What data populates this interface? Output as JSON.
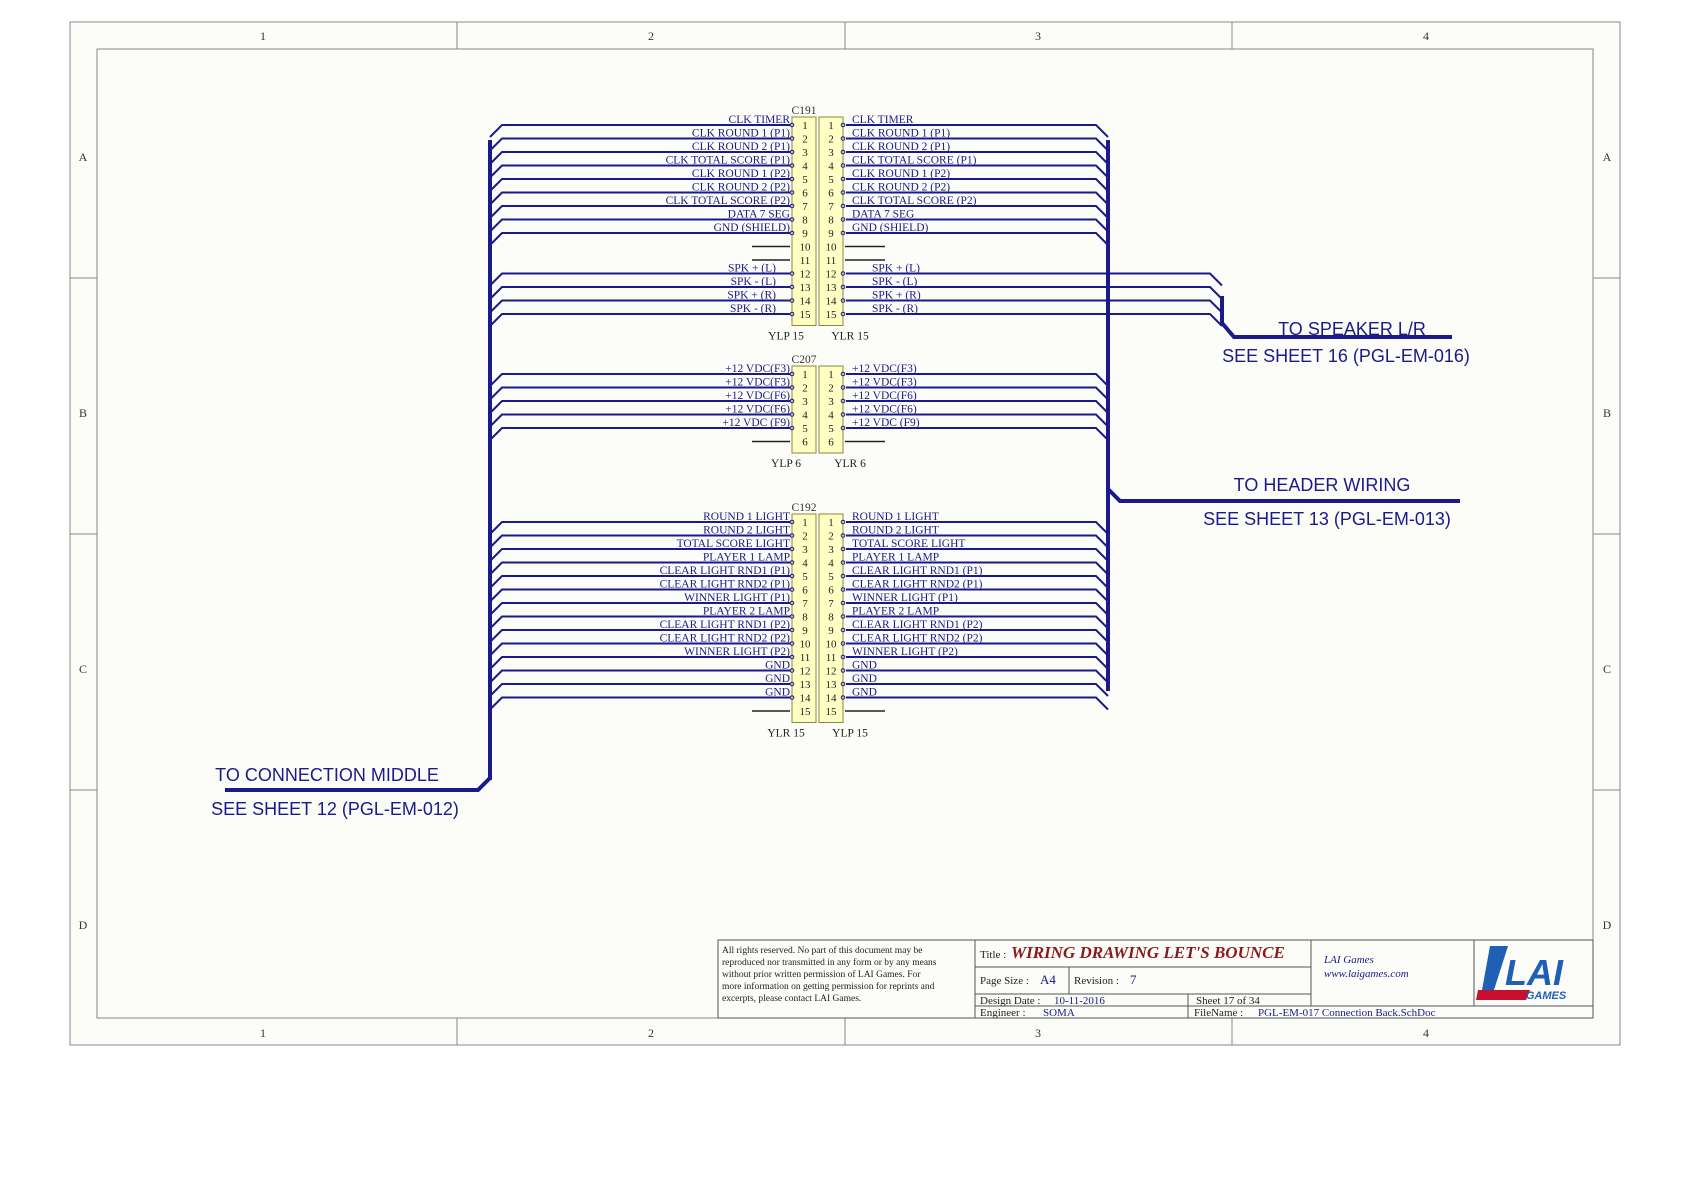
{
  "frame": {
    "columns": [
      "1",
      "2",
      "3",
      "4"
    ],
    "rows": [
      "A",
      "B",
      "C",
      "D"
    ]
  },
  "colors": {
    "wire": "#1a1a8c",
    "label": "#1a1a8c",
    "connector_fill": "#ffffc4",
    "connector_stroke": "#8a8a3a",
    "sheet_bg": "#fcfcf8",
    "title_red": "#8b1a1a"
  },
  "connectors": {
    "c191": {
      "ref": "C191",
      "left_name": "YLP 15",
      "right_name": "YLR 15",
      "pins": [
        "1",
        "2",
        "3",
        "4",
        "5",
        "6",
        "7",
        "8",
        "9",
        "10",
        "11",
        "12",
        "13",
        "14",
        "15"
      ],
      "left_labels": [
        "CLK TIMER",
        "CLK ROUND 1 (P1)",
        "CLK ROUND 2 (P1)",
        "CLK TOTAL SCORE (P1)",
        "CLK ROUND 1 (P2)",
        "CLK ROUND 2 (P2)",
        "CLK TOTAL SCORE (P2)",
        "DATA 7 SEG",
        "GND (SHIELD)",
        "",
        "",
        "SPK + (L)",
        "SPK - (L)",
        "SPK + (R)",
        "SPK - (R)"
      ],
      "right_labels": [
        "CLK TIMER",
        "CLK ROUND 1 (P1)",
        "CLK ROUND 2 (P1)",
        "CLK TOTAL SCORE (P1)",
        "CLK ROUND 1 (P2)",
        "CLK ROUND 2 (P2)",
        "CLK TOTAL SCORE (P2)",
        "DATA 7 SEG",
        "GND (SHIELD)",
        "",
        "",
        "SPK + (L)",
        "SPK - (L)",
        "SPK + (R)",
        "SPK - (R)"
      ]
    },
    "c207": {
      "ref": "C207",
      "left_name": "YLP 6",
      "right_name": "YLR 6",
      "pins": [
        "1",
        "2",
        "3",
        "4",
        "5",
        "6"
      ],
      "left_labels": [
        "+12 VDC(F3)",
        "+12 VDC(F3)",
        "+12 VDC(F6)",
        "+12 VDC(F6)",
        "+12 VDC (F9)",
        ""
      ],
      "right_labels": [
        "+12 VDC(F3)",
        "+12 VDC(F3)",
        "+12 VDC(F6)",
        "+12 VDC(F6)",
        "+12 VDC (F9)",
        ""
      ]
    },
    "c192": {
      "ref": "C192",
      "left_name": "YLR 15",
      "right_name": "YLP 15",
      "pins": [
        "1",
        "2",
        "3",
        "4",
        "5",
        "6",
        "7",
        "8",
        "9",
        "10",
        "11",
        "12",
        "13",
        "14",
        "15"
      ],
      "left_labels": [
        "ROUND 1 LIGHT",
        "ROUND 2 LIGHT",
        "TOTAL SCORE LIGHT",
        "PLAYER 1 LAMP",
        "CLEAR LIGHT RND1 (P1)",
        "CLEAR LIGHT RND2 (P1)",
        "WINNER LIGHT (P1)",
        "PLAYER 2 LAMP",
        "CLEAR LIGHT RND1 (P2)",
        "CLEAR LIGHT RND2 (P2)",
        "WINNER LIGHT (P2)",
        "GND",
        "GND",
        "GND",
        ""
      ],
      "right_labels": [
        "ROUND 1 LIGHT",
        "ROUND 2 LIGHT",
        "TOTAL SCORE LIGHT",
        "PLAYER 1 LAMP",
        "CLEAR LIGHT RND1 (P1)",
        "CLEAR LIGHT RND2 (P1)",
        "WINNER LIGHT (P1)",
        "PLAYER 2 LAMP",
        "CLEAR LIGHT RND1 (P2)",
        "CLEAR LIGHT RND2 (P2)",
        "WINNER LIGHT (P2)",
        "GND",
        "GND",
        "GND",
        ""
      ]
    }
  },
  "offsheet": {
    "speaker_title": "TO SPEAKER L/R",
    "speaker_ref": "SEE SHEET 16 (PGL-EM-016)",
    "header_title": "TO HEADER WIRING",
    "header_ref": "SEE SHEET 13 (PGL-EM-013)",
    "middle_title": "TO CONNECTION MIDDLE",
    "middle_ref": "SEE SHEET 12 (PGL-EM-012)"
  },
  "title_block": {
    "notice": [
      "All rights reserved. No part of this document may be",
      "reproduced nor transmitted in any form or by any means",
      "without prior written permission of LAI Games. For",
      "more information on getting permission for reprints and",
      "excerpts, please contact LAI Games."
    ],
    "title_label": "Title :",
    "title": "WIRING DRAWING LET'S BOUNCE",
    "page_size_label": "Page Size :",
    "page_size": "A4",
    "revision_label": "Revision :",
    "revision": "7",
    "company": "LAI Games",
    "website": "www.laigames.com",
    "design_date_label": "Design Date :",
    "design_date": "10-11-2016",
    "sheet": "Sheet 17 of 34",
    "engineer_label": "Engineer :",
    "engineer": "SOMA",
    "filename_label": "FileName :",
    "filename": "PGL-EM-017 Connection Back.SchDoc",
    "logo_text": "LAI",
    "logo_sub": "GAMES"
  }
}
